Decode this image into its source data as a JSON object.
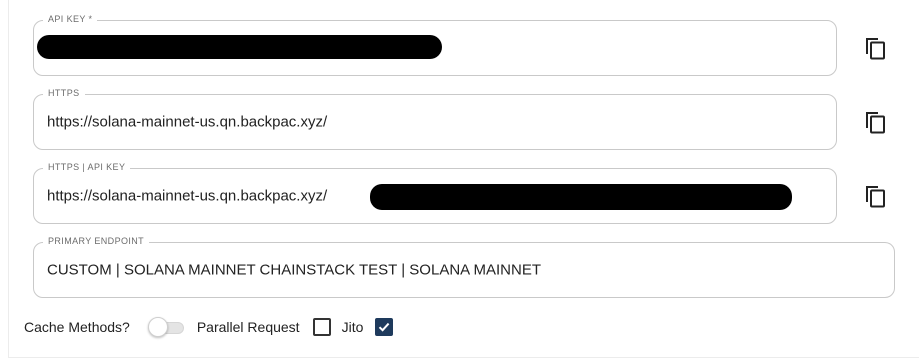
{
  "fields": {
    "api_key": {
      "legend": "API KEY *",
      "value": ""
    },
    "https": {
      "legend": "HTTPS",
      "value": "https://solana-mainnet-us.qn.backpac.xyz/"
    },
    "https_api_key": {
      "legend": "HTTPS | API KEY",
      "value": "https://solana-mainnet-us.qn.backpac.xyz/"
    },
    "primary_endpoint": {
      "legend": "PRIMARY ENDPOINT",
      "value": "CUSTOM | SOLANA MAINNET CHAINSTACK TEST | SOLANA MAINNET"
    }
  },
  "controls": {
    "cache_methods_label": "Cache Methods?",
    "cache_methods_on": false,
    "parallel_request_label": "Parallel Request",
    "parallel_request_checked": false,
    "jito_label": "Jito",
    "jito_checked": true
  },
  "icons": {
    "copy": "copy-icon",
    "check": "checkmark-icon"
  },
  "colors": {
    "checkbox_checked": "#1e3a5c",
    "border": "#c9c9c9",
    "redaction": "#000000"
  }
}
